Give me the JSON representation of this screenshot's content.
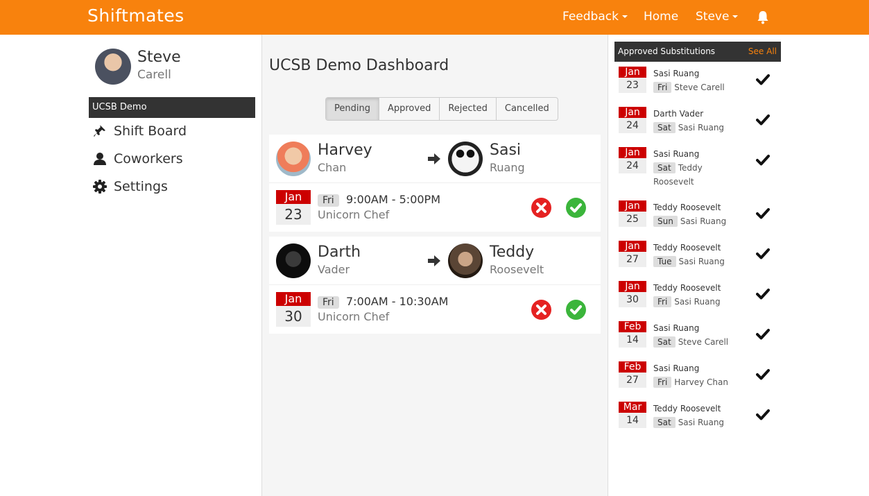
{
  "app": {
    "brand": "Shiftmates"
  },
  "nav": {
    "feedback": "Feedback",
    "home": "Home",
    "user": "Steve"
  },
  "profile": {
    "first_name": "Steve",
    "last_name": "Carell"
  },
  "sidebar": {
    "org": "UCSB Demo",
    "items": [
      {
        "label": "Shift Board",
        "icon": "pin-icon"
      },
      {
        "label": "Coworkers",
        "icon": "user-icon"
      },
      {
        "label": "Settings",
        "icon": "gear-icon"
      }
    ]
  },
  "main": {
    "title": "UCSB Demo Dashboard",
    "tabs": [
      {
        "label": "Pending",
        "active": true
      },
      {
        "label": "Approved",
        "active": false
      },
      {
        "label": "Rejected",
        "active": false
      },
      {
        "label": "Cancelled",
        "active": false
      }
    ],
    "requests": [
      {
        "from_first": "Harvey",
        "from_last": "Chan",
        "to_first": "Sasi",
        "to_last": "Ruang",
        "month": "Jan",
        "day": "23",
        "dow": "Fri",
        "time": "9:00AM - 5:00PM",
        "role": "Unicorn Chef"
      },
      {
        "from_first": "Darth",
        "from_last": "Vader",
        "to_first": "Teddy",
        "to_last": "Roosevelt",
        "month": "Jan",
        "day": "30",
        "dow": "Fri",
        "time": "7:00AM - 10:30AM",
        "role": "Unicorn Chef"
      }
    ]
  },
  "approved": {
    "title": "Approved Substitutions",
    "see_all": "See All",
    "items": [
      {
        "month": "Jan",
        "day": "23",
        "from": "Sasi Ruang",
        "dow": "Fri",
        "to": "Steve Carell"
      },
      {
        "month": "Jan",
        "day": "24",
        "from": "Darth Vader",
        "dow": "Sat",
        "to": "Sasi Ruang"
      },
      {
        "month": "Jan",
        "day": "24",
        "from": "Sasi Ruang",
        "dow": "Sat",
        "to": "Teddy Roosevelt"
      },
      {
        "month": "Jan",
        "day": "25",
        "from": "Teddy Roosevelt",
        "dow": "Sun",
        "to": "Sasi Ruang"
      },
      {
        "month": "Jan",
        "day": "27",
        "from": "Teddy Roosevelt",
        "dow": "Tue",
        "to": "Sasi Ruang"
      },
      {
        "month": "Jan",
        "day": "30",
        "from": "Teddy Roosevelt",
        "dow": "Fri",
        "to": "Sasi Ruang"
      },
      {
        "month": "Feb",
        "day": "14",
        "from": "Sasi Ruang",
        "dow": "Sat",
        "to": "Steve Carell"
      },
      {
        "month": "Feb",
        "day": "27",
        "from": "Sasi Ruang",
        "dow": "Fri",
        "to": "Harvey Chan"
      },
      {
        "month": "Mar",
        "day": "14",
        "from": "Teddy Roosevelt",
        "dow": "Sat",
        "to": "Sasi Ruang"
      }
    ]
  },
  "colors": {
    "brand": "#f8820d",
    "reject": "#e52222",
    "approve": "#3bb53b",
    "date": "#cc0000"
  }
}
